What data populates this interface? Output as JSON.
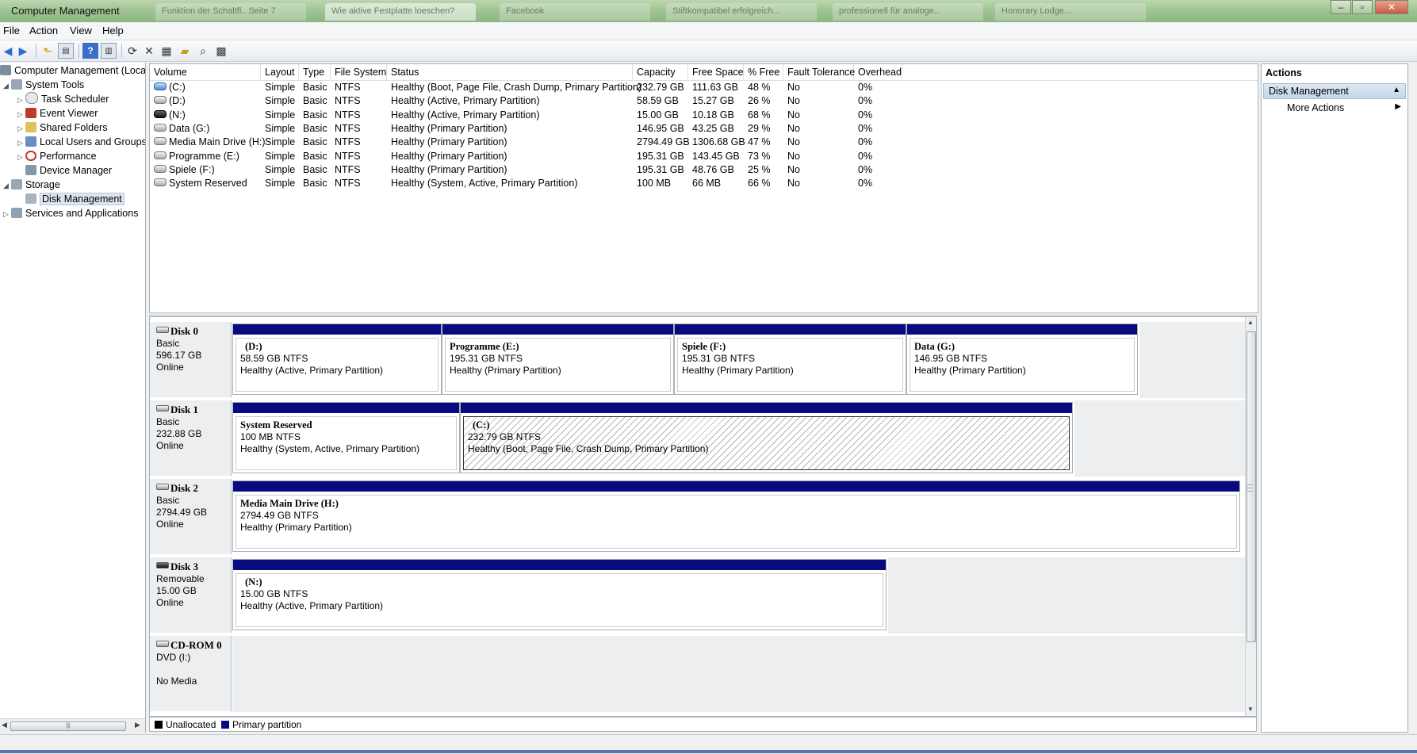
{
  "window": {
    "title": "Computer Management",
    "background_tabs": [
      "Funktion der Schaltfl.. Seite 7",
      "Wie aktive Festplatte loeschen?",
      "Facebook",
      "Stiftkompatibel erfolgreich...",
      "professionell für analoge...",
      "Honorary Lodge..."
    ]
  },
  "menu": {
    "items": [
      "File",
      "Action",
      "View",
      "Help"
    ]
  },
  "toolbar": {
    "icons": [
      "back-icon",
      "forward-icon",
      "up-icon",
      "show-hide-tree-icon",
      "help-icon",
      "show-hide-action-icon",
      "refresh-icon",
      "delete-icon",
      "properties-icon",
      "open-icon",
      "search-icon",
      "rescan-icon"
    ]
  },
  "tree": {
    "root": "Computer Management (Local",
    "nodes": [
      {
        "label": "System Tools"
      },
      {
        "label": "Task Scheduler"
      },
      {
        "label": "Event Viewer"
      },
      {
        "label": "Shared Folders"
      },
      {
        "label": "Local Users and Groups"
      },
      {
        "label": "Performance"
      },
      {
        "label": "Device Manager"
      },
      {
        "label": "Storage"
      },
      {
        "label": "Disk Management"
      },
      {
        "label": "Services and Applications"
      }
    ]
  },
  "volume_table": {
    "columns": [
      "Volume",
      "Layout",
      "Type",
      "File System",
      "Status",
      "Capacity",
      "Free Space",
      "% Free",
      "Fault Tolerance",
      "Overhead"
    ],
    "rows": [
      [
        "(C:)",
        "Simple",
        "Basic",
        "NTFS",
        "Healthy (Boot, Page File, Crash Dump, Primary Partition)",
        "232.79 GB",
        "111.63 GB",
        "48 %",
        "No",
        "0%"
      ],
      [
        "(D:)",
        "Simple",
        "Basic",
        "NTFS",
        "Healthy (Active, Primary Partition)",
        "58.59 GB",
        "15.27 GB",
        "26 %",
        "No",
        "0%"
      ],
      [
        "(N:)",
        "Simple",
        "Basic",
        "NTFS",
        "Healthy (Active, Primary Partition)",
        "15.00 GB",
        "10.18 GB",
        "68 %",
        "No",
        "0%"
      ],
      [
        "Data (G:)",
        "Simple",
        "Basic",
        "NTFS",
        "Healthy (Primary Partition)",
        "146.95 GB",
        "43.25 GB",
        "29 %",
        "No",
        "0%"
      ],
      [
        "Media Main Drive (H:)",
        "Simple",
        "Basic",
        "NTFS",
        "Healthy (Primary Partition)",
        "2794.49 GB",
        "1306.68 GB",
        "47 %",
        "No",
        "0%"
      ],
      [
        "Programme (E:)",
        "Simple",
        "Basic",
        "NTFS",
        "Healthy (Primary Partition)",
        "195.31 GB",
        "143.45 GB",
        "73 %",
        "No",
        "0%"
      ],
      [
        "Spiele (F:)",
        "Simple",
        "Basic",
        "NTFS",
        "Healthy (Primary Partition)",
        "195.31 GB",
        "48.76 GB",
        "25 %",
        "No",
        "0%"
      ],
      [
        "System Reserved",
        "Simple",
        "Basic",
        "NTFS",
        "Healthy (System, Active, Primary Partition)",
        "100 MB",
        "66 MB",
        "66 %",
        "No",
        "0%"
      ]
    ]
  },
  "disks": [
    {
      "name": "Disk 0",
      "type": "Basic",
      "size": "596.17 GB",
      "status": "Online",
      "partitions": [
        {
          "label": "(D:)",
          "size": "58.59 GB NTFS",
          "status": "Healthy (Active, Primary Partition)"
        },
        {
          "label": "Programme  (E:)",
          "size": "195.31 GB NTFS",
          "status": "Healthy (Primary Partition)"
        },
        {
          "label": "Spiele  (F:)",
          "size": "195.31 GB NTFS",
          "status": "Healthy (Primary Partition)"
        },
        {
          "label": "Data  (G:)",
          "size": "146.95 GB NTFS",
          "status": "Healthy (Primary Partition)"
        }
      ]
    },
    {
      "name": "Disk 1",
      "type": "Basic",
      "size": "232.88 GB",
      "status": "Online",
      "partitions": [
        {
          "label": "System Reserved",
          "size": "100 MB NTFS",
          "status": "Healthy (System, Active, Primary Partition)"
        },
        {
          "label": "(C:)",
          "size": "232.79 GB NTFS",
          "status": "Healthy (Boot, Page File, Crash Dump, Primary Partition)"
        }
      ]
    },
    {
      "name": "Disk 2",
      "type": "Basic",
      "size": "2794.49 GB",
      "status": "Online",
      "partitions": [
        {
          "label": "Media Main Drive  (H:)",
          "size": "2794.49 GB NTFS",
          "status": "Healthy (Primary Partition)"
        }
      ]
    },
    {
      "name": "Disk 3",
      "type": "Removable",
      "size": "15.00 GB",
      "status": "Online",
      "partitions": [
        {
          "label": "(N:)",
          "size": "15.00 GB NTFS",
          "status": "Healthy (Active, Primary Partition)"
        }
      ]
    },
    {
      "name": "CD-ROM 0",
      "type": "DVD (I:)",
      "size": "",
      "status": "No Media",
      "partitions": []
    }
  ],
  "legend": [
    {
      "label": "Unallocated",
      "color": "#000000"
    },
    {
      "label": "Primary partition",
      "color": "#0a0a80"
    }
  ],
  "actions": {
    "title": "Actions",
    "group": "Disk Management",
    "items": [
      "More Actions"
    ]
  },
  "colors": {
    "partition_bar": "#0a0a80",
    "titlebar": "#9ec392",
    "selection": "#dde6ef"
  }
}
